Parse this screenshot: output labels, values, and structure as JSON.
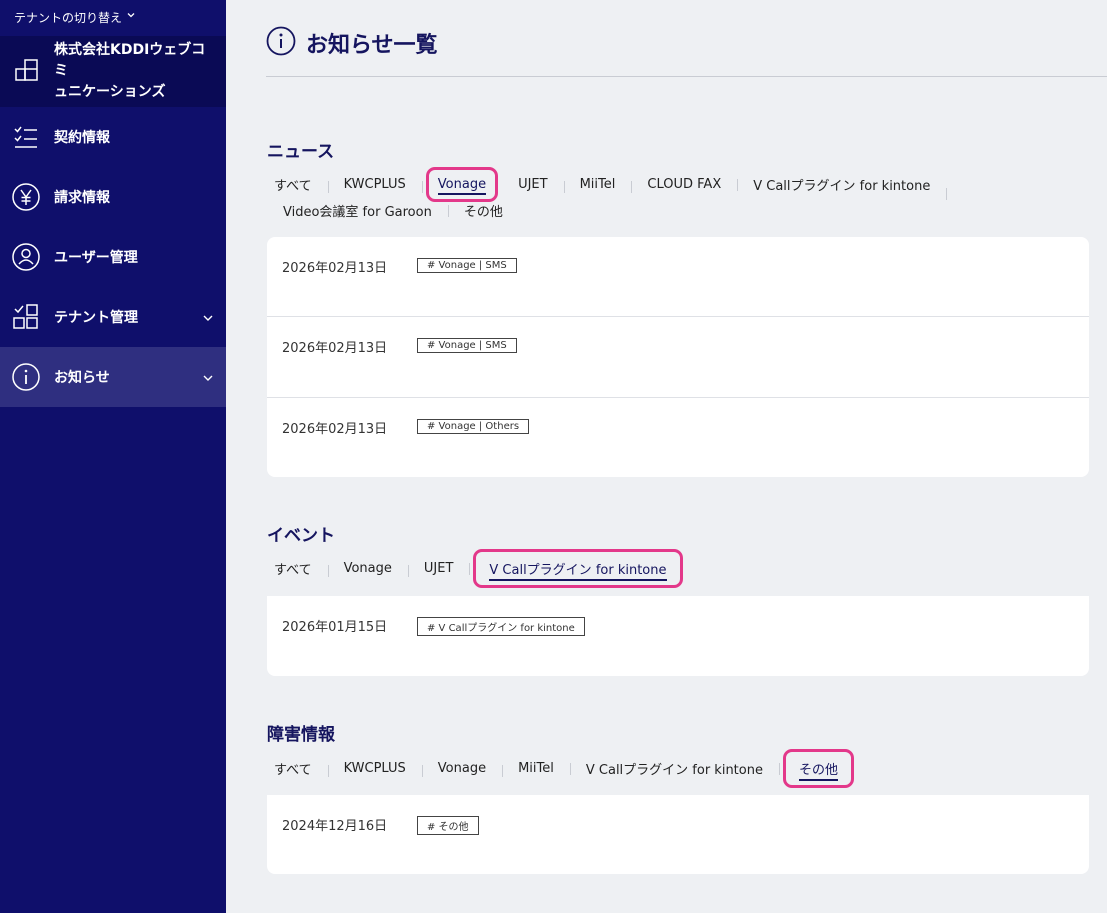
{
  "sidebar": {
    "tenant_switch": "テナントの切り替え",
    "company_line1": "株式会社KDDIウェブコミ",
    "company_line2": "ュニケーションズ",
    "items": [
      {
        "label": "契約情報",
        "icon": "checklist-icon"
      },
      {
        "label": "請求情報",
        "icon": "yen-icon"
      },
      {
        "label": "ユーザー管理",
        "icon": "user-icon"
      },
      {
        "label": "テナント管理",
        "icon": "grid-icon"
      },
      {
        "label": "お知らせ",
        "icon": "info-icon"
      }
    ]
  },
  "page": {
    "title": "お知らせ一覧"
  },
  "news": {
    "title": "ニュース",
    "tabs": [
      "すべて",
      "KWCPLUS",
      "Vonage",
      "UJET",
      "MiiTel",
      "CLOUD FAX",
      "V Callプラグイン for kintone",
      "Video会議室 for Garoon",
      "その他"
    ],
    "selected": "Vonage",
    "items": [
      {
        "date": "2026年02月13日",
        "tag": "# Vonage | SMS"
      },
      {
        "date": "2026年02月13日",
        "tag": "# Vonage | SMS"
      },
      {
        "date": "2026年02月13日",
        "tag": "# Vonage | Others"
      }
    ]
  },
  "events": {
    "title": "イベント",
    "tabs": [
      "すべて",
      "Vonage",
      "UJET",
      "V Callプラグイン for kintone"
    ],
    "selected": "V Callプラグイン for kintone",
    "items": [
      {
        "date": "2026年01月15日",
        "tag": "# V Callプラグイン for kintone"
      }
    ]
  },
  "incidents": {
    "title": "障害情報",
    "tabs": [
      "すべて",
      "KWCPLUS",
      "Vonage",
      "MiiTel",
      "V Callプラグイン for kintone",
      "その他"
    ],
    "selected": "その他",
    "items": [
      {
        "date": "2024年12月16日",
        "tag": "# その他"
      }
    ]
  },
  "colors": {
    "sidebar": "#0f0f6b",
    "accent": "#15155f",
    "highlight": "#e3388a"
  }
}
